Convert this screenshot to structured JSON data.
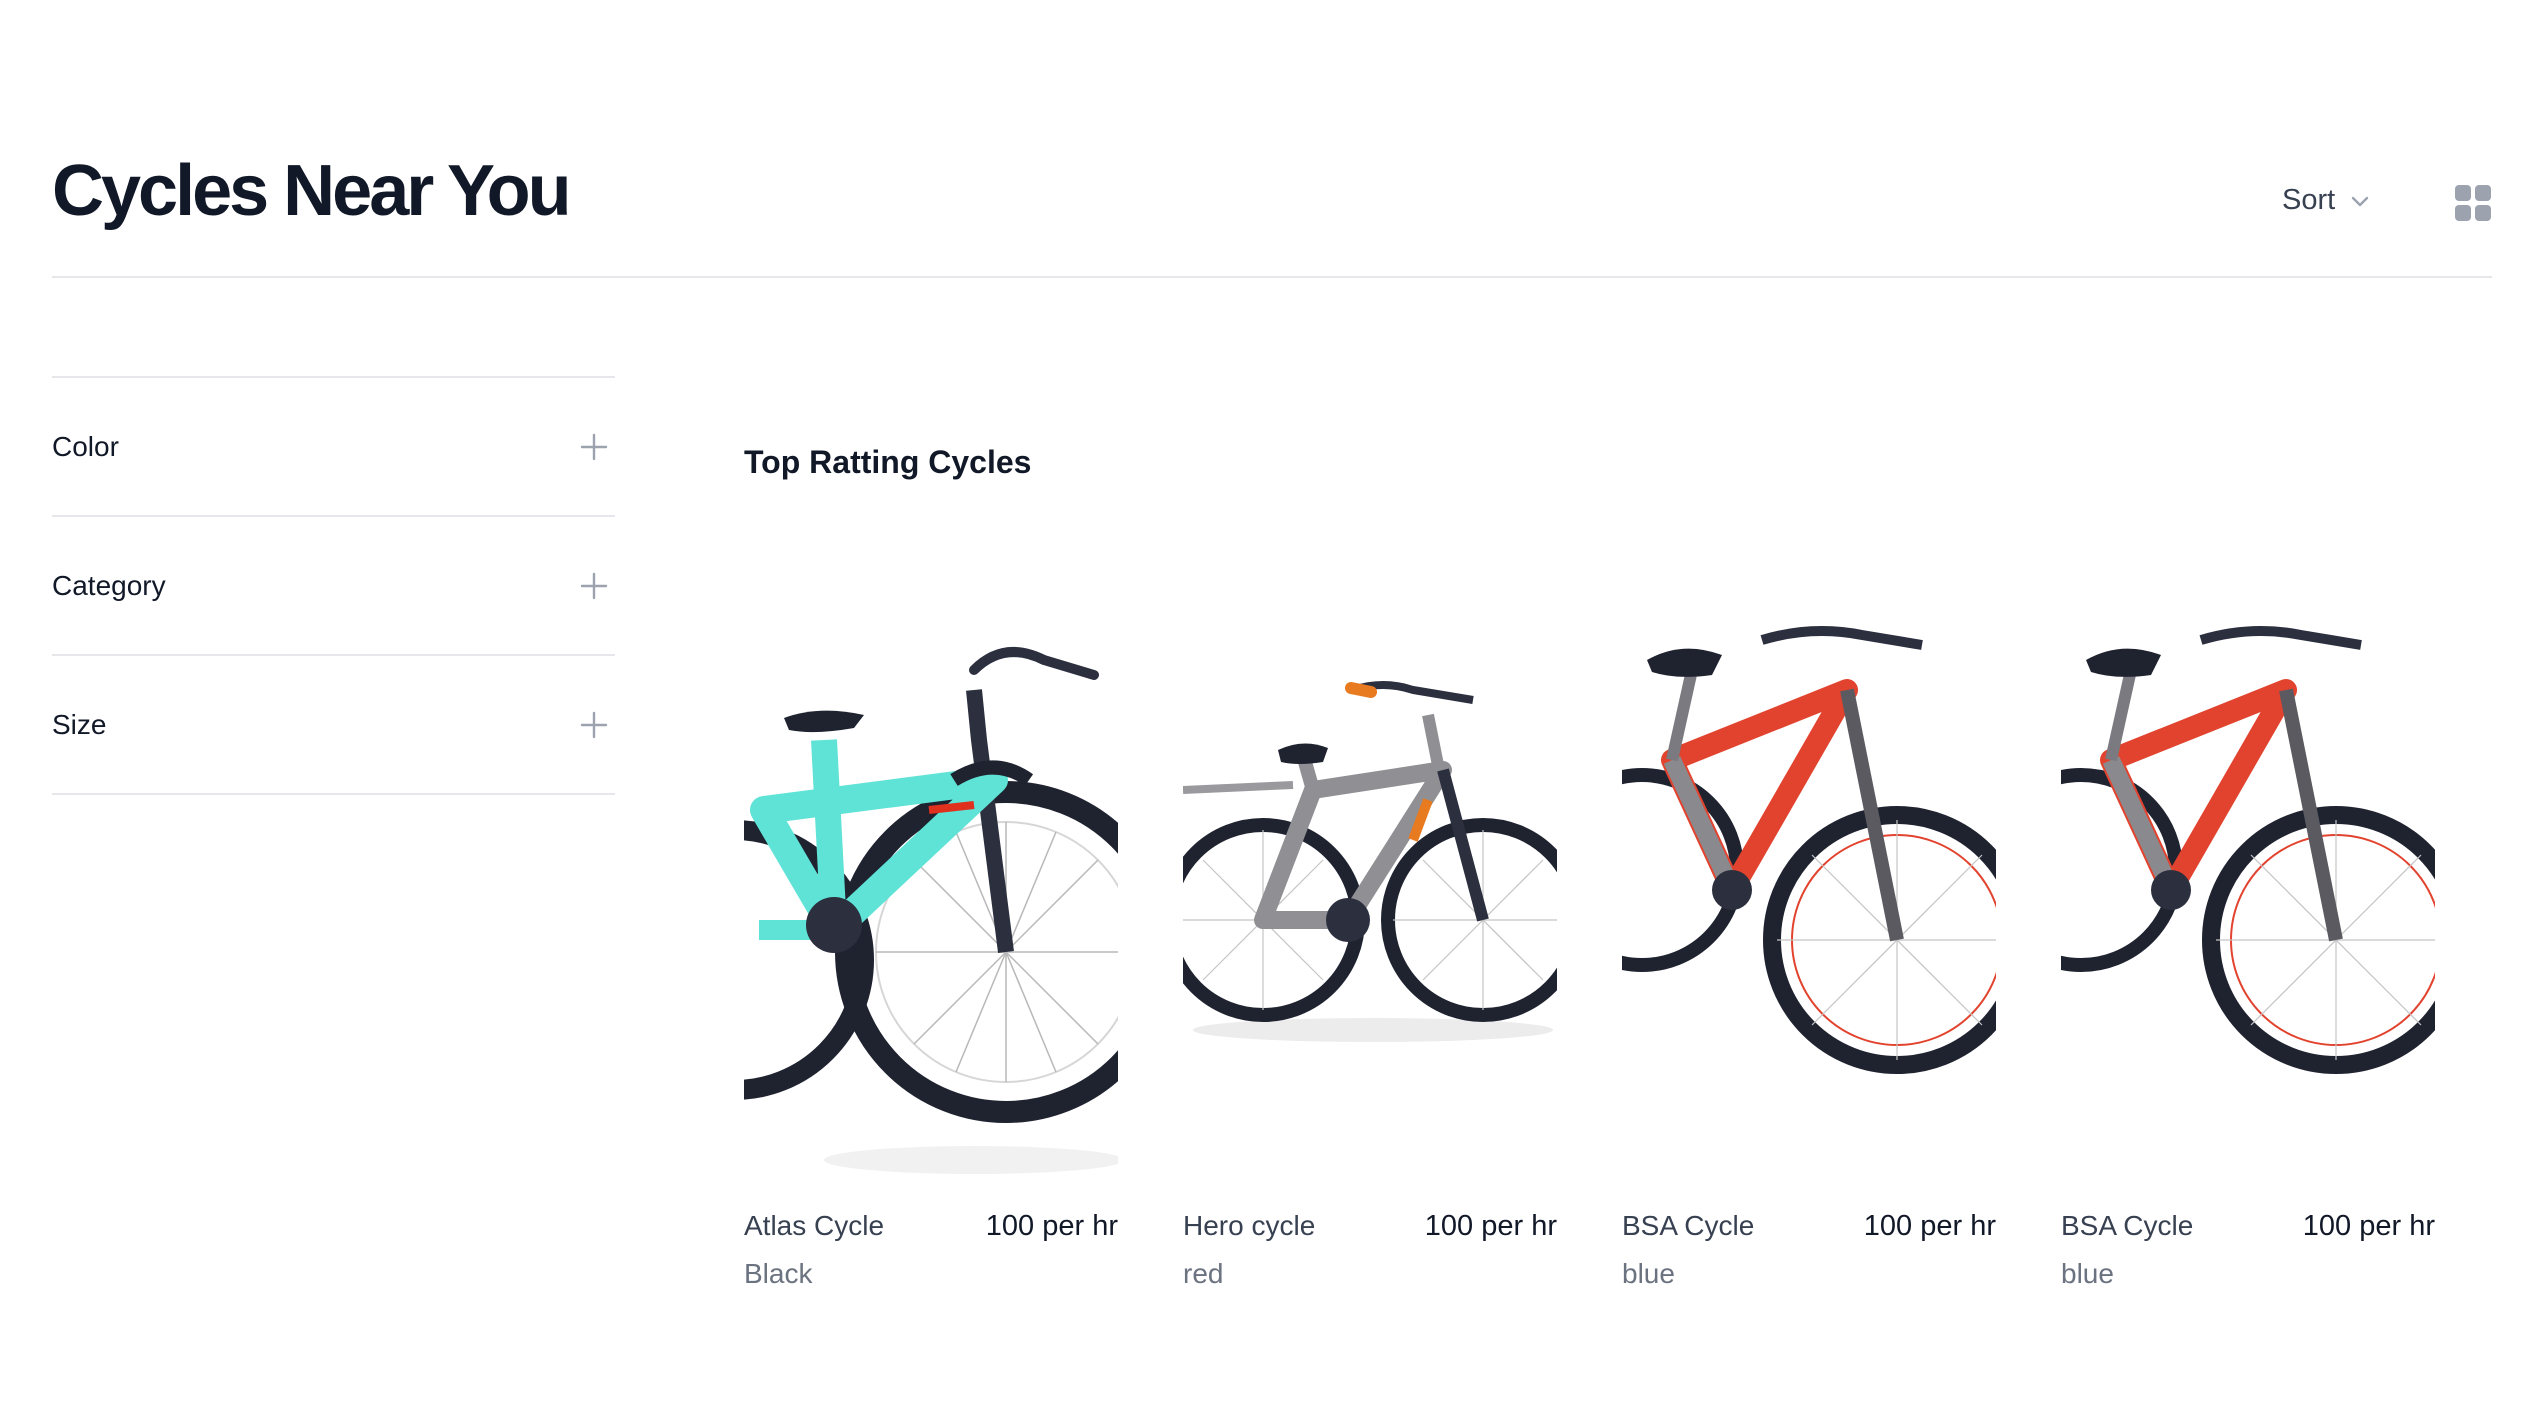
{
  "header": {
    "title": "Cycles Near You",
    "sort_label": "Sort"
  },
  "filters": [
    {
      "label": "Color"
    },
    {
      "label": "Category"
    },
    {
      "label": "Size"
    }
  ],
  "section_title": "Top Ratting Cycles",
  "products": [
    {
      "name": "Atlas Cycle",
      "price": "100 per hr",
      "color": "Black",
      "frame_color": "#5fe3d6"
    },
    {
      "name": "Hero cycle",
      "price": "100 per hr",
      "color": "red",
      "frame_color": "#8f8f94"
    },
    {
      "name": "BSA Cycle",
      "price": "100 per hr",
      "color": "blue",
      "frame_color": "#e2432e"
    },
    {
      "name": "BSA Cycle",
      "price": "100 per hr",
      "color": "blue",
      "frame_color": "#e2432e"
    }
  ],
  "icons": {
    "sort": "chevron-down-icon",
    "view": "grid-icon",
    "filter_expand": "plus-icon"
  }
}
